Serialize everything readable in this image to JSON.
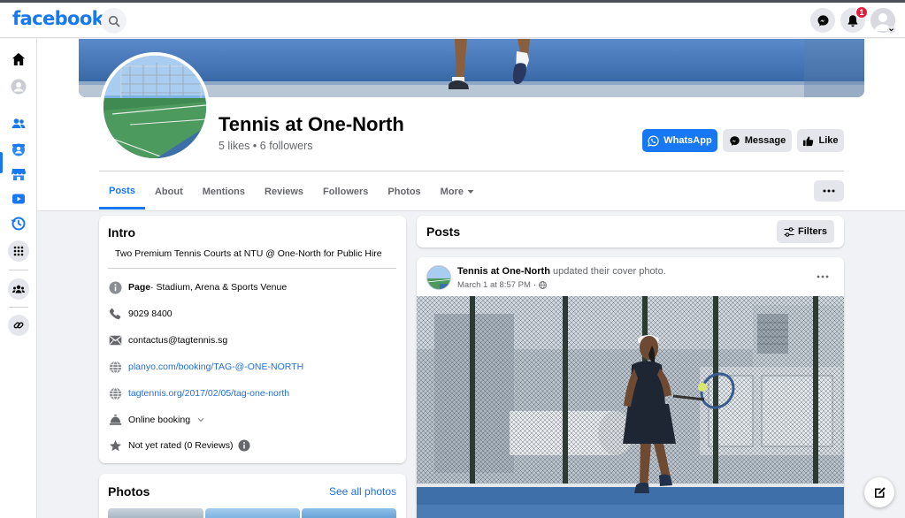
{
  "topbar": {
    "logo": "facebook",
    "search_icon": "search-icon",
    "messenger_icon": "messenger-icon",
    "notifications_icon": "bell-icon",
    "notification_count": "1",
    "account_icon": "account-avatar"
  },
  "leftnav": {
    "items": [
      "home-icon",
      "profile-icon",
      "friends-icon",
      "groups-icon",
      "marketplace-icon",
      "watch-icon",
      "memories-icon",
      "menu-grid-icon",
      "communities-icon",
      "link-icon"
    ],
    "active": "friends-icon"
  },
  "page": {
    "title": "Tennis at One-North",
    "likes": "5 likes",
    "followers": "6 followers",
    "separator": "•"
  },
  "actions": {
    "whatsapp": "WhatsApp",
    "message": "Message",
    "like": "Like"
  },
  "tabs": [
    {
      "label": "Posts",
      "active": true
    },
    {
      "label": "About"
    },
    {
      "label": "Mentions"
    },
    {
      "label": "Reviews"
    },
    {
      "label": "Followers"
    },
    {
      "label": "Photos"
    },
    {
      "label": "More"
    }
  ],
  "intro": {
    "title": "Intro",
    "description": "Two Premium Tennis Courts at NTU @ One-North for Public Hire",
    "category_bold": "Page",
    "category": " · Stadium, Arena & Sports Venue",
    "phone": "9029 8400",
    "email": "contactus@tagtennis.sg",
    "website1": "planyo.com/booking/TAG-@-ONE-NORTH",
    "website2": "tagtennis.org/2017/02/05/tag-one-north",
    "booking": "Online booking",
    "rating": "Not yet rated (0 Reviews)"
  },
  "photos": {
    "title": "Photos",
    "see_all": "See all photos"
  },
  "posts": {
    "title": "Posts",
    "filters": "Filters",
    "post": {
      "author": "Tennis at One-North",
      "action": " updated their cover photo.",
      "date": "March 1 at 8:57 PM",
      "dot": "·",
      "privacy_icon": "globe-icon"
    }
  },
  "colors": {
    "brand": "#1877f2",
    "link": "#216fdb",
    "badge": "#e41e3f",
    "background": "#f0f2f5"
  }
}
